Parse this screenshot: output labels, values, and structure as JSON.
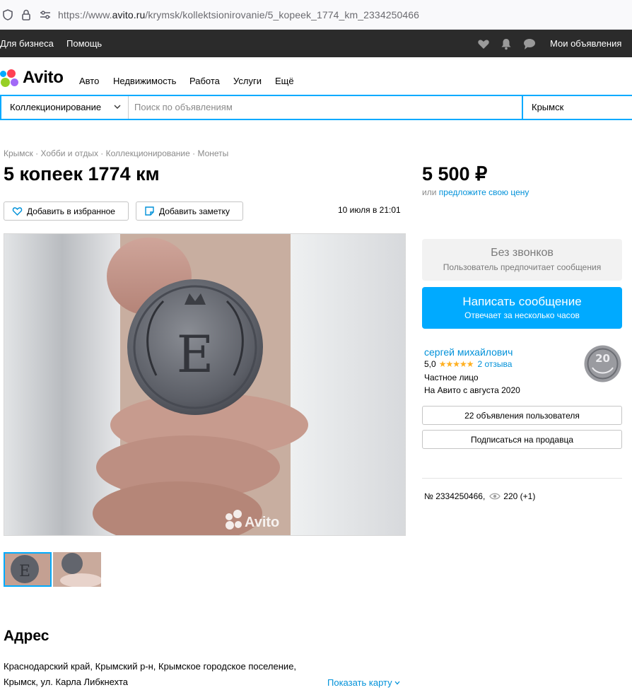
{
  "browser": {
    "url_prefix": "https://www.",
    "url_domain": "avito.ru",
    "url_path": "/krymsk/kollektsionirovanie/5_kopeek_1774_km_2334250466"
  },
  "topbar": {
    "business": "Для бизнеса",
    "help": "Помощь",
    "my_ads": "Мои объявления"
  },
  "header": {
    "logo_text": "Avito",
    "nav": [
      "Авто",
      "Недвижимость",
      "Работа",
      "Услуги",
      "Ещё"
    ]
  },
  "search": {
    "category": "Коллекционирование",
    "placeholder": "Поиск по объявлениям",
    "city": "Крымск"
  },
  "breadcrumb": "Крымск · Хобби и отдых · Коллекционирование · Монеты",
  "listing": {
    "title": "5 копеек 1774 км",
    "price": "5 500 ₽",
    "offer_prefix": "или",
    "offer_link": "предложите свою цену",
    "add_favorite": "Добавить в избранное",
    "add_note": "Добавить заметку",
    "date": "10 июля в 21:01",
    "watermark": "Avito"
  },
  "contact": {
    "no_calls_title": "Без звонков",
    "no_calls_sub": "Пользователь предпочитает сообщения",
    "write_title": "Написать сообщение",
    "write_sub": "Отвечает за несколько часов"
  },
  "seller": {
    "name": "сергей михайлович",
    "rating": "5,0",
    "stars": "★★★★★",
    "reviews": "2 отзыва",
    "type": "Частное лицо",
    "since": "На Авито с августа 2020",
    "ads_button": "22 объявления пользователя",
    "subscribe_button": "Подписаться на продавца"
  },
  "meta": {
    "item_number": "№ 2334250466,",
    "views": "220 (+1)"
  },
  "address": {
    "heading": "Адрес",
    "text": "Краснодарский край, Крымский р-н, Крымское городское поселение, Крымск, ул. Карла Либкнехта",
    "map_link": "Показать карту"
  },
  "colors": {
    "accent": "#00aaff",
    "link": "#0091d9",
    "topbar": "#2b2b2b",
    "star": "#ffb021"
  }
}
